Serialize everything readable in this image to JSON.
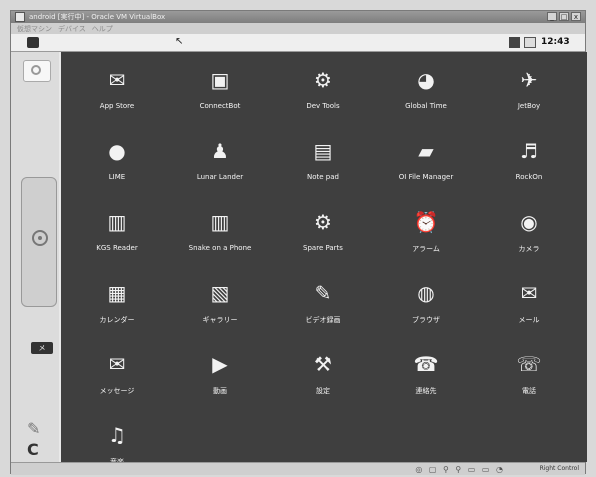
{
  "window": {
    "title": "android [実行中] - Oracle VM VirtualBox",
    "menu": [
      "仮想マシン",
      "デバイス",
      "ヘルプ"
    ],
    "controls": [
      "_",
      "□",
      "x"
    ]
  },
  "statusbar": {
    "clock": "12:43"
  },
  "side": {
    "badge": "メ"
  },
  "apps": [
    {
      "label": "App Store",
      "icon": "shopping-bag-icon",
      "glyph": "✉"
    },
    {
      "label": "ConnectBot",
      "icon": "terminal-icon",
      "glyph": "▣"
    },
    {
      "label": "Dev Tools",
      "icon": "gear-icon",
      "glyph": "⚙"
    },
    {
      "label": "Global Time",
      "icon": "globe-clock-icon",
      "glyph": "◕"
    },
    {
      "label": "JetBoy",
      "icon": "spaceship-icon",
      "glyph": "✈"
    },
    {
      "label": "LIME",
      "icon": "speech-bubble-icon",
      "glyph": "●"
    },
    {
      "label": "Lunar Lander",
      "icon": "lunar-lander-icon",
      "glyph": "♟"
    },
    {
      "label": "Note pad",
      "icon": "notepad-icon",
      "glyph": "▤"
    },
    {
      "label": "OI File Manager",
      "icon": "folder-icon",
      "glyph": "▰"
    },
    {
      "label": "RockOn",
      "icon": "music-player-icon",
      "glyph": "♬"
    },
    {
      "label": "KGS Reader",
      "icon": "document-reader-icon",
      "glyph": "▥"
    },
    {
      "label": "Snake on a Phone",
      "icon": "snake-game-icon",
      "glyph": "▥"
    },
    {
      "label": "Spare Parts",
      "icon": "gear-icon",
      "glyph": "⚙"
    },
    {
      "label": "アラーム",
      "icon": "alarm-clock-icon",
      "glyph": "⏰"
    },
    {
      "label": "カメラ",
      "icon": "camera-icon",
      "glyph": "◉"
    },
    {
      "label": "カレンダー",
      "icon": "calendar-icon",
      "glyph": "▦"
    },
    {
      "label": "ギャラリー",
      "icon": "gallery-icon",
      "glyph": "▧"
    },
    {
      "label": "ビデオ録画",
      "icon": "video-camera-icon",
      "glyph": "✎"
    },
    {
      "label": "ブラウザ",
      "icon": "browser-globe-icon",
      "glyph": "◍"
    },
    {
      "label": "メール",
      "icon": "mail-icon",
      "glyph": "✉"
    },
    {
      "label": "メッセージ",
      "icon": "messaging-icon",
      "glyph": "✉"
    },
    {
      "label": "動画",
      "icon": "video-play-icon",
      "glyph": "▶"
    },
    {
      "label": "設定",
      "icon": "settings-sliders-icon",
      "glyph": "⚒"
    },
    {
      "label": "連絡先",
      "icon": "contacts-icon",
      "glyph": "☎"
    },
    {
      "label": "電話",
      "icon": "phone-icon",
      "glyph": "☏"
    },
    {
      "label": "音楽",
      "icon": "music-icon",
      "glyph": "♫"
    }
  ],
  "host_status": {
    "icons": "◎ ▢ ⚲ ⚲ ▭ ▭ ◔",
    "hostkey": "Right Control"
  },
  "colors": {
    "drawer_bg": "#3f3f3f",
    "label": "#f5f5f5"
  }
}
